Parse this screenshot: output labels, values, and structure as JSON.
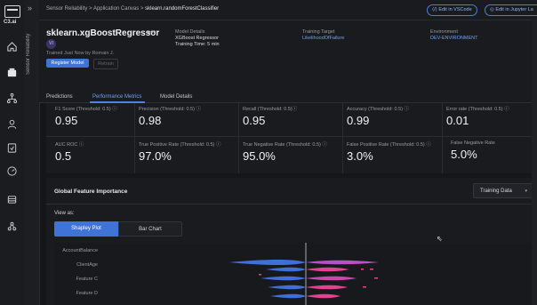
{
  "app": {
    "logo_text": "C3.ai"
  },
  "sidebar_rail": {
    "icons": [
      "home-icon",
      "apps-icon",
      "network-icon",
      "user-icon",
      "page-icon",
      "gauge-icon",
      "database-icon",
      "flow-icon"
    ]
  },
  "secondary_rail": {
    "title": "Sensor Reliability"
  },
  "breadcrumb": {
    "part1": "Sensor Reliability",
    "sep1": ">",
    "part2": "Application Canvas",
    "sep2": ">",
    "part3": "sklearn.randomForestClassifier"
  },
  "top_actions": {
    "edit_vscode": "Edit in VSCode",
    "edit_jupyter": "Edit in Jupyter La"
  },
  "model": {
    "name": "sklearn.xgBoostRegressor",
    "more": "•••",
    "avatar_initials": "VI",
    "trained_text": "Trained Just Now by Romain J.",
    "register_label": "Register Model",
    "retrain_label": "Retrain",
    "details_label": "Model Details",
    "details_line1": "XGBoost Regressor",
    "details_line2": "Training Time: 5 min",
    "target_label": "Training Target",
    "target_value": "LikelihoodOfFailure",
    "env_label": "Environment",
    "env_value": "DEV-ENVIRONMENT"
  },
  "tabs": [
    "Predictions",
    "Performance Metrics",
    "Model Details"
  ],
  "metrics": {
    "row1": [
      {
        "label": "F1 Score (Threshold: 0.5) ⓘ",
        "value": "0.95"
      },
      {
        "label": "Precision (Threshold: 0.5) ⓘ",
        "value": "0.98"
      },
      {
        "label": "Recall (Threshold: 0.5)ⓘ",
        "value": "0.95"
      },
      {
        "label": "Accuracy (Threshold: 0.5) ⓘ",
        "value": "0.99"
      },
      {
        "label": "Error rate (Threshold: 0.5) ⓘ",
        "value": "0.01"
      }
    ],
    "row2": [
      {
        "label": "AUC ROC ⓘ",
        "value": "0.5"
      },
      {
        "label": "True Positive Rate (Threshold: 0.5) ⓘ",
        "value": "97.0%"
      },
      {
        "label": "True Negative Rate (Threshold: 0.5) ⓘ",
        "value": "95.0%"
      },
      {
        "label": "False Positive Rate (Threshold: 0.5) ⓘ",
        "value": "3.0%"
      },
      {
        "label": "False Negative Rate",
        "value": "5.0%"
      }
    ]
  },
  "feature_importance": {
    "title": "Global Feature Importance",
    "dataset_select": "Training Data",
    "view_as": "View as:",
    "toggle_on": "Shapley Plot",
    "toggle_off": "Bar Chart",
    "features": [
      "AccountBalance",
      "ClientAge",
      "Feature C",
      "Feature D"
    ]
  },
  "colors": {
    "accent": "#3f74d6",
    "positive": "#e0448f",
    "negative": "#3f6fd8"
  }
}
